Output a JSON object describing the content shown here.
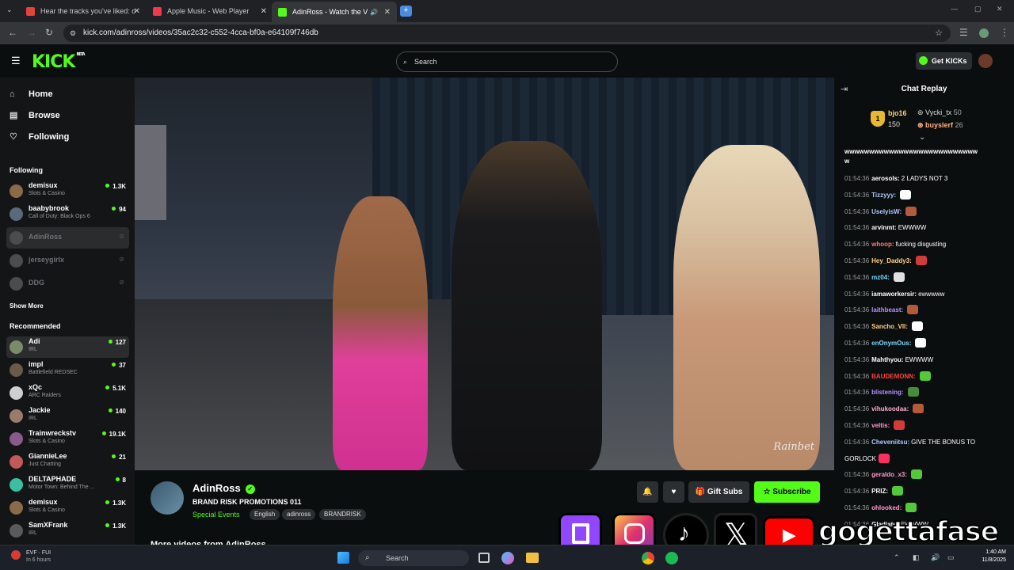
{
  "browser": {
    "tabs": [
      {
        "title": "Hear the tracks you've liked: on",
        "fav": "#e0443a"
      },
      {
        "title": "Apple Music - Web Player",
        "fav": "#f0384f"
      },
      {
        "title": "AdinRoss - Watch the VOD",
        "fav": "#53fc18"
      }
    ],
    "url": "kick.com/adinross/videos/35ac2c32-c552-4cca-bf0a-e64109f746db"
  },
  "header": {
    "logo": "KICK",
    "logo_badge": "BETA",
    "search_placeholder": "Search",
    "get_kicks": "Get KICKs"
  },
  "sidebar": {
    "nav": [
      "Home",
      "Browse",
      "Following"
    ],
    "following_title": "Following",
    "following": [
      {
        "name": "demisux",
        "cat": "Slots & Casino",
        "viewers": "1.3K",
        "online": true
      },
      {
        "name": "baabybrook",
        "cat": "Call of Duty: Black Ops 6",
        "viewers": "94",
        "online": true
      },
      {
        "name": "AdinRoss",
        "cat": "",
        "viewers": "",
        "online": false
      },
      {
        "name": "jerseygirlx",
        "cat": "",
        "viewers": "",
        "online": false
      },
      {
        "name": "DDG",
        "cat": "",
        "viewers": "",
        "online": false
      }
    ],
    "show_more": "Show More",
    "recommended_title": "Recommended",
    "recommended": [
      {
        "name": "Adi",
        "cat": "IRL",
        "viewers": "127"
      },
      {
        "name": "impl",
        "cat": "Battlefield REDSEC",
        "viewers": "37"
      },
      {
        "name": "xQc",
        "cat": "ARC Raiders",
        "viewers": "5.1K"
      },
      {
        "name": "Jackie",
        "cat": "IRL",
        "viewers": "140"
      },
      {
        "name": "Trainwreckstv",
        "cat": "Slots & Casino",
        "viewers": "19.1K"
      },
      {
        "name": "GiannieLee",
        "cat": "Just Chatting",
        "viewers": "21"
      },
      {
        "name": "DELTAPHADE",
        "cat": "Motor Town: Behind The ...",
        "viewers": "8"
      },
      {
        "name": "demisux",
        "cat": "Slots & Casino",
        "viewers": "1.3K"
      },
      {
        "name": "SamXFrank",
        "cat": "IRL",
        "viewers": "1.3K"
      }
    ]
  },
  "video": {
    "watermark": "Rainbet",
    "streamer": "AdinRoss",
    "title": "BRAND RISK PROMOTIONS 011",
    "category": "Special Events",
    "tags": [
      "English",
      "adinross",
      "BRANDRISK"
    ],
    "gift_subs": "Gift Subs",
    "subscribe": "Subscribe",
    "more_videos": "More videos from AdinRoss"
  },
  "chat": {
    "title": "Chat Replay",
    "leaders": [
      {
        "name": "bjo16",
        "value": "150"
      },
      {
        "name": "Vycki_tx",
        "value": "50"
      },
      {
        "name": "buyslerf",
        "value": "26"
      }
    ],
    "first_line_a": "wwwwwwwwwwwwwwwwwwwwwwwwwww",
    "first_line_b": "w",
    "messages": [
      {
        "ts": "01:54:36",
        "user": "aerosols:",
        "color": "#ffffff",
        "text": "2 LADYS NOT 3",
        "emote": ""
      },
      {
        "ts": "01:54:36",
        "user": "Tizzyyy:",
        "color": "#b0c8ff",
        "text": "",
        "emote": "#ffffff"
      },
      {
        "ts": "01:54:36",
        "user": "UselyisW:",
        "color": "#b0c8ff",
        "text": "",
        "emote": "#b35a3a"
      },
      {
        "ts": "01:54:36",
        "user": "arvinmt:",
        "color": "#ffffff",
        "text": "EWWWW",
        "emote": ""
      },
      {
        "ts": "01:54:36",
        "user": "whoop:",
        "color": "#ff7a7a",
        "text": "fucking disgusting",
        "emote": ""
      },
      {
        "ts": "01:54:36",
        "user": "Hey_Daddy3:",
        "color": "#ffd27a",
        "text": "",
        "emote": "#d33a3a"
      },
      {
        "ts": "01:54:36",
        "user": "mz04:",
        "color": "#7ad7ff",
        "text": "",
        "emote": "#e0e0e0"
      },
      {
        "ts": "01:54:36",
        "user": "iamaworkersir:",
        "color": "#ffffff",
        "text": "ewwwww",
        "emote": ""
      },
      {
        "ts": "01:54:36",
        "user": "laithbeast:",
        "color": "#b890ff",
        "text": "",
        "emote": "#b35a3a"
      },
      {
        "ts": "01:54:36",
        "user": "Sancho_Vll:",
        "color": "#ffd27a",
        "text": "",
        "emote": "#ffffff"
      },
      {
        "ts": "01:54:36",
        "user": "enOnymOus:",
        "color": "#7ad7ff",
        "text": "",
        "emote": "#ffffff"
      },
      {
        "ts": "01:54:36",
        "user": "Mahthyou:",
        "color": "#ffffff",
        "text": "EWWWW",
        "emote": ""
      },
      {
        "ts": "01:54:36",
        "user": "BAUDEMONN:",
        "color": "#ff4040",
        "text": "",
        "emote": "#53c83a"
      },
      {
        "ts": "01:54:36",
        "user": "blistening:",
        "color": "#b890ff",
        "text": "",
        "emote": "#4a8a3a"
      },
      {
        "ts": "01:54:36",
        "user": "vihukoodaa:",
        "color": "#ffb0d0",
        "text": "",
        "emote": "#b35a3a"
      },
      {
        "ts": "01:54:36",
        "user": "veltis:",
        "color": "#ff9ad0",
        "text": "",
        "emote": "#d33a3a"
      },
      {
        "ts": "01:54:36",
        "user": "Cheveniitsu:",
        "color": "#b0c8ff",
        "text": "GIVE THE BONUS TO",
        "emote": ""
      },
      {
        "ts": "",
        "user": "",
        "color": "#ffffff",
        "text": "GORLOCK",
        "emote": "#ff3060"
      },
      {
        "ts": "01:54:36",
        "user": "geraldo_x3:",
        "color": "#ff9ad0",
        "text": "",
        "emote": "#53c83a"
      },
      {
        "ts": "01:54:36",
        "user": "PRIZ:",
        "color": "#ffffff",
        "text": "",
        "emote": "#53c83a"
      },
      {
        "ts": "01:54:36",
        "user": "ohlooked:",
        "color": "#ff9ad0",
        "text": "",
        "emote": "#53c83a"
      },
      {
        "ts": "01:54:36",
        "user": "Gladiate:",
        "color": "#ffffff",
        "text": "EWWWW",
        "emote": ""
      }
    ]
  },
  "overlay": {
    "handle": "gogettafase",
    "icons": [
      "twitch-icon",
      "instagram-icon",
      "tiktok-icon",
      "x-icon",
      "youtube-icon"
    ]
  },
  "taskbar": {
    "weather_temp": "EVF · FUI",
    "weather_sub": "In 6 hours",
    "search": "Search",
    "time": "1:40 AM",
    "date": "11/8/2025"
  }
}
